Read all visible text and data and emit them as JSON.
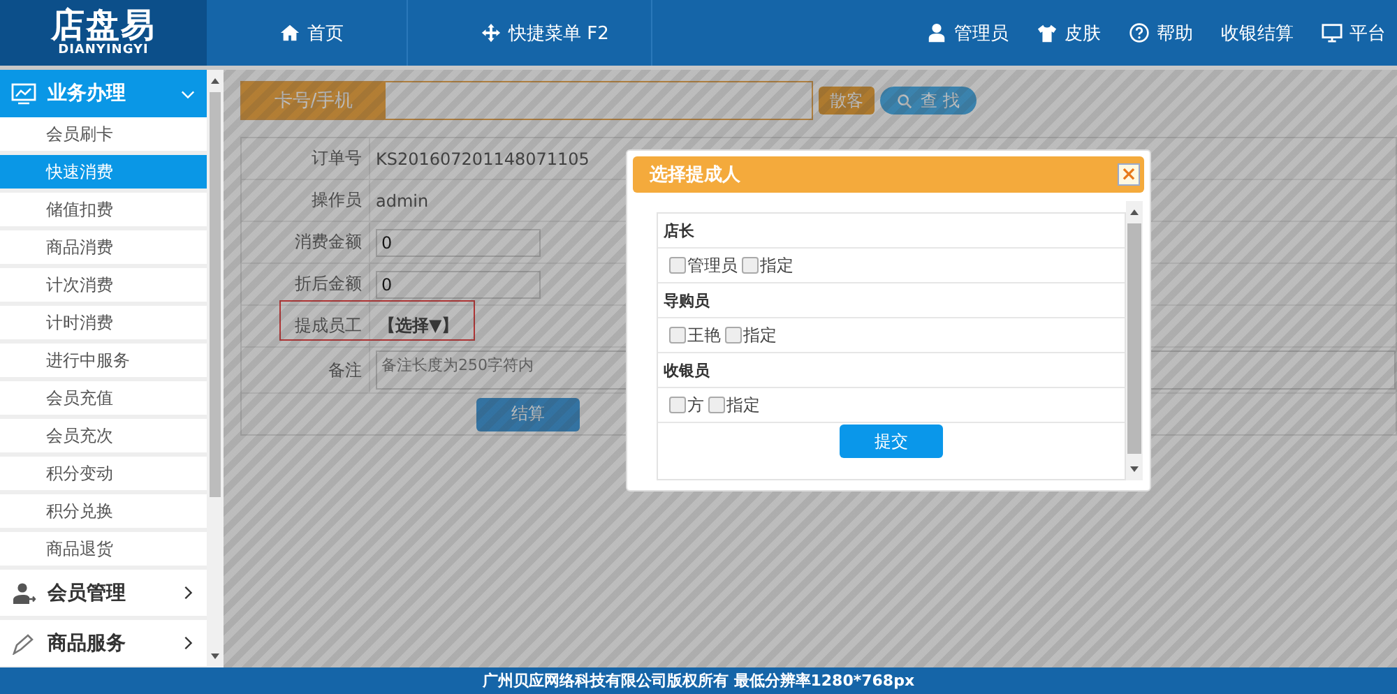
{
  "header": {
    "logo": {
      "title": "店盘易",
      "subtitle": "DIANYINGYI"
    },
    "nav_left": [
      {
        "kind": "home",
        "label": "首页"
      },
      {
        "kind": "move",
        "label": "快捷菜单 F2"
      }
    ],
    "nav_right": [
      {
        "kind": "user",
        "label": "管理员"
      },
      {
        "kind": "shirt",
        "label": "皮肤"
      },
      {
        "kind": "help",
        "label": "帮助"
      },
      {
        "kind": "none",
        "label": "收银结算"
      },
      {
        "kind": "monitor",
        "label": "平台"
      }
    ]
  },
  "sidebar": {
    "groups": [
      {
        "kind": "desk",
        "label": "业务办理",
        "expanded": true,
        "items": [
          {
            "label": "会员刷卡",
            "selected": false
          },
          {
            "label": "快速消费",
            "selected": true
          },
          {
            "label": "储值扣费",
            "selected": false
          },
          {
            "label": "商品消费",
            "selected": false
          },
          {
            "label": "计次消费",
            "selected": false
          },
          {
            "label": "计时消费",
            "selected": false
          },
          {
            "label": "进行中服务",
            "selected": false
          },
          {
            "label": "会员充值",
            "selected": false
          },
          {
            "label": "会员充次",
            "selected": false
          },
          {
            "label": "积分变动",
            "selected": false
          },
          {
            "label": "积分兑换",
            "selected": false
          },
          {
            "label": "商品退货",
            "selected": false
          }
        ]
      },
      {
        "kind": "user",
        "label": "会员管理",
        "expanded": false
      },
      {
        "kind": "pen",
        "label": "商品服务",
        "expanded": false
      }
    ]
  },
  "search": {
    "label": "卡号/手机",
    "buttons": [
      {
        "kind": "walkin",
        "label": "散客"
      },
      {
        "kind": "search",
        "label": "查 找"
      }
    ]
  },
  "form": {
    "rows": [
      {
        "kind": "text",
        "label": "订单号",
        "value": "KS201607201148071105",
        "highlighted": false
      },
      {
        "kind": "text",
        "label": "操作员",
        "value": "admin",
        "highlighted": false
      },
      {
        "kind": "input",
        "label": "消费金额",
        "value": "0",
        "highlighted": false
      },
      {
        "kind": "input",
        "label": "折后金额",
        "value": "0",
        "highlighted": false
      },
      {
        "kind": "select",
        "label": "提成员工",
        "value": "【选择▼】",
        "highlighted": true
      },
      {
        "kind": "textarea",
        "label": "备注",
        "placeholder": "备注长度为250字符内",
        "highlighted": false
      }
    ],
    "submit": "结算"
  },
  "dialog": {
    "title": "选择提成人",
    "close": "×",
    "groups": [
      {
        "title": "店长",
        "options": [
          {
            "label": "管理员",
            "checked": false
          },
          {
            "label": "指定",
            "checked": false
          }
        ]
      },
      {
        "title": "导购员",
        "options": [
          {
            "label": "王艳",
            "checked": false
          },
          {
            "label": "指定",
            "checked": false
          }
        ]
      },
      {
        "title": "收银员",
        "options": [
          {
            "label": "方",
            "checked": false
          },
          {
            "label": "指定",
            "checked": false
          }
        ]
      }
    ],
    "submit": "提交"
  },
  "footer": "广州贝应网络科技有限公司版权所有 最低分辨率1280*768px"
}
